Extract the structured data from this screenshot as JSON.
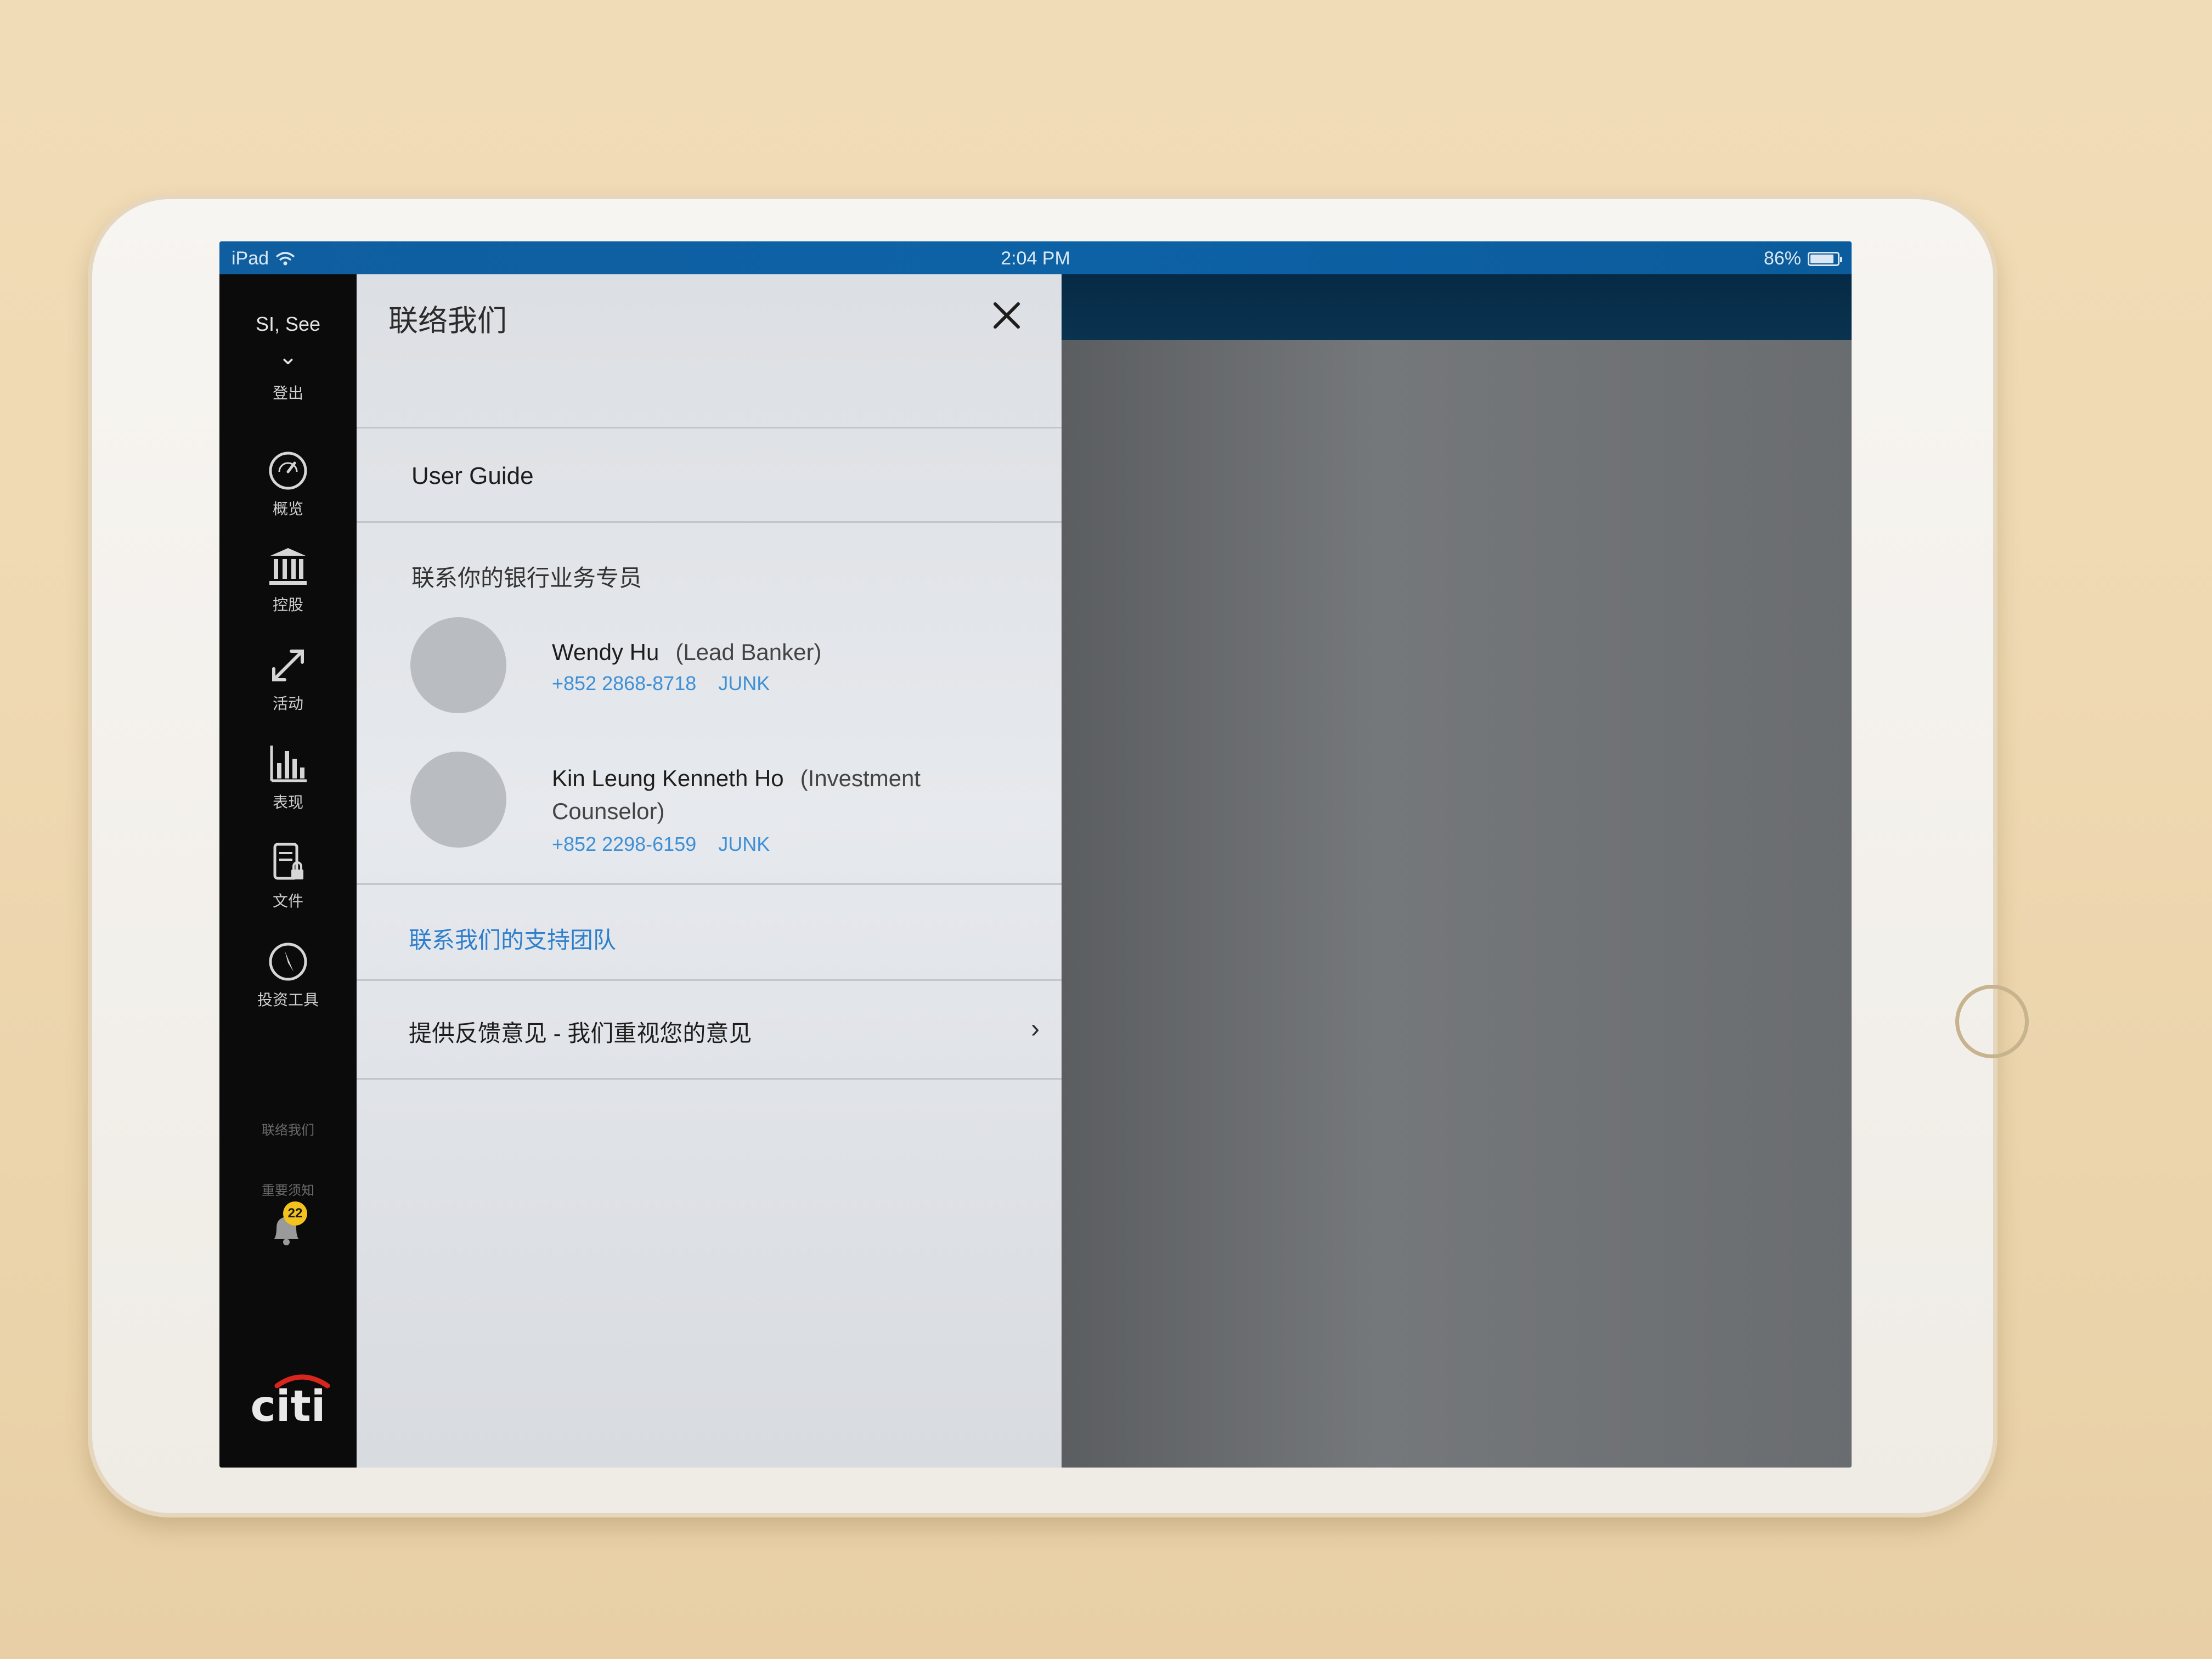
{
  "status_bar": {
    "device": "iPad",
    "time": "2:04 PM",
    "battery": "86%"
  },
  "sidebar": {
    "user_name": "SI, See",
    "chevron": "⌄",
    "logout": "登出",
    "items": [
      {
        "label": "概览",
        "icon": "gauge-icon"
      },
      {
        "label": "控股",
        "icon": "bank-icon"
      },
      {
        "label": "活动",
        "icon": "arrows-icon"
      },
      {
        "label": "表现",
        "icon": "bar-chart-icon"
      },
      {
        "label": "文件",
        "icon": "document-lock-icon"
      },
      {
        "label": "投资工具",
        "icon": "compass-icon"
      }
    ],
    "contact_us": "联络我们",
    "important_notice": "重要须知",
    "notification_count": "22",
    "brand": "citi"
  },
  "panel": {
    "title": "联络我们",
    "user_guide": "User Guide",
    "contact_heading": "联系你的银行业务专员",
    "contacts": [
      {
        "name": "Wendy Hu",
        "role": "(Lead Banker)",
        "role_cont": "",
        "phone": "+852 2868-8718",
        "tag": "JUNK"
      },
      {
        "name": "Kin Leung Kenneth Ho",
        "role": "(Investment",
        "role_cont": "Counselor)",
        "phone": "+852 2298-6159",
        "tag": "JUNK"
      }
    ],
    "support_link": "联系我们的支持团队",
    "feedback": "提供反馈意见 - 我们重视您的意见",
    "feedback_chevron": "›"
  },
  "colors": {
    "status_bar": "#0d62a6",
    "sidebar_bg": "#0b0b0b",
    "link": "#2e7fcd",
    "badge": "#f4c21d",
    "citi_red": "#d9261c"
  }
}
